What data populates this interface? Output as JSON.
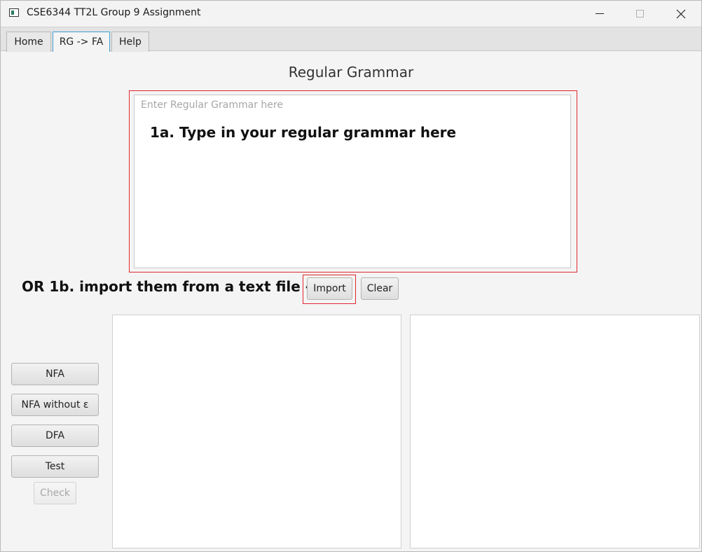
{
  "window": {
    "title": "CSE6344 TT2L Group 9 Assignment",
    "controls": [
      "minimize-icon",
      "maximize-icon",
      "close-icon"
    ]
  },
  "tabs": [
    {
      "label": "Home",
      "active": false
    },
    {
      "label": "RG -> FA",
      "active": true
    },
    {
      "label": "Help",
      "active": false
    }
  ],
  "main": {
    "heading": "Regular Grammar",
    "grammar_input": {
      "value": "",
      "placeholder": "Enter Regular Grammar here"
    },
    "instruction_1a": "1a. Type in your regular grammar here",
    "instruction_1b": "OR 1b. import them from a text file -->",
    "import_label": "Import",
    "clear_label": "Clear"
  },
  "side_buttons": [
    {
      "label": "NFA",
      "enabled": true
    },
    {
      "label": "NFA without ε",
      "enabled": true
    },
    {
      "label": "DFA",
      "enabled": true
    },
    {
      "label": "Test",
      "enabled": true
    },
    {
      "label": "Check",
      "enabled": false
    }
  ],
  "colors": {
    "highlight": "#e0282e",
    "active_tab_border": "#3f9fd6"
  }
}
